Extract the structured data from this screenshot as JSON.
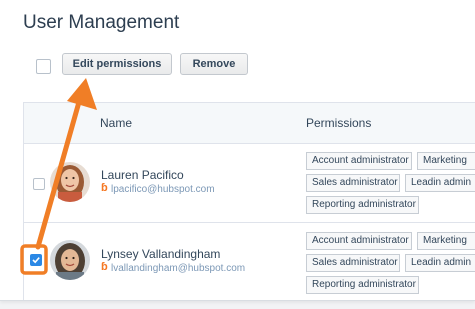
{
  "page": {
    "title": "User Management"
  },
  "toolbar": {
    "edit_permissions_label": "Edit permissions",
    "remove_label": "Remove"
  },
  "table": {
    "columns": [
      "Name",
      "Permissions"
    ],
    "rows": [
      {
        "name": "Lauren Pacifico",
        "email": "lpacifico@hubspot.com",
        "selected": false,
        "permissions": [
          "Account administrator",
          "Marketing",
          "Sales administrator",
          "Leadin admin",
          "Reporting administrator"
        ]
      },
      {
        "name": "Lynsey Vallandingham",
        "email": "lvallandingham@hubspot.com",
        "selected": true,
        "permissions": [
          "Account administrator",
          "Marketing",
          "Sales administrator",
          "Leadin admin",
          "Reporting administrator"
        ]
      }
    ]
  },
  "icons": {
    "email_prefix": "hubspot-sprocket-icon",
    "checkmark": "checkmark-icon",
    "annotation_arrow": "arrow-icon"
  },
  "colors": {
    "annotation": "#f07e26",
    "checkbox_checked": "#2b88e5",
    "email": "#7c98b6",
    "sprocket": "#f57722"
  }
}
